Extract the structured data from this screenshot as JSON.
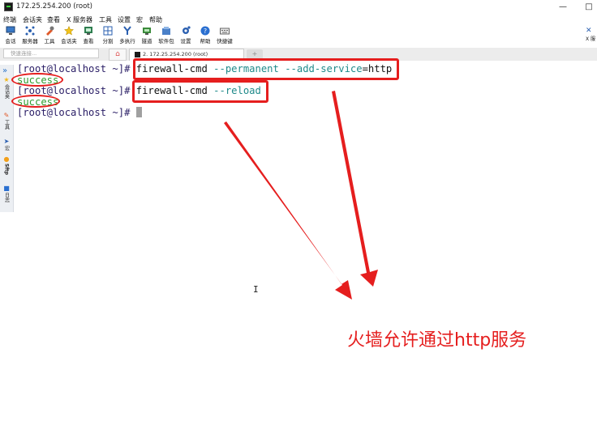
{
  "window": {
    "title": "172.25.254.200 (root)",
    "minimize": "—",
    "maximize": "□"
  },
  "menu": [
    "终端",
    "会话夹",
    "查看",
    "X 服务器",
    "工具",
    "设置",
    "宏",
    "帮助"
  ],
  "toolbar": [
    {
      "label": "会话",
      "icon": "monitor-icon"
    },
    {
      "label": "服务器",
      "icon": "network-icon"
    },
    {
      "label": "工具",
      "icon": "tools-icon"
    },
    {
      "label": "会话夹",
      "icon": "star-icon"
    },
    {
      "label": "查看",
      "icon": "view-icon"
    },
    {
      "label": "分割",
      "icon": "split-icon"
    },
    {
      "label": "多执行",
      "icon": "fork-icon"
    },
    {
      "label": "隧道",
      "icon": "tunnel-icon"
    },
    {
      "label": "软件包",
      "icon": "package-icon"
    },
    {
      "label": "设置",
      "icon": "gear-icon"
    },
    {
      "label": "帮助",
      "icon": "help-icon"
    },
    {
      "label": "快捷键",
      "icon": "keyboard-icon"
    }
  ],
  "toolbar_extra": {
    "label": "X 服"
  },
  "tabs": {
    "quick_connect_placeholder": "快速连接...",
    "active": "2. 172.25.254.200 (root)",
    "home_glyph": "⌂",
    "new_glyph": "+"
  },
  "sidebar": {
    "items": [
      "会话夹",
      "工具",
      "宏",
      "Sftp",
      "日志"
    ]
  },
  "terminal": {
    "prompt": "[root@localhost ~]# ",
    "lines": [
      {
        "cmd": "firewall-cmd ",
        "opt": "--permanent --add-service",
        "rest": "=http"
      },
      {
        "output": "success"
      },
      {
        "cmd": "firewall-cmd ",
        "opt": "--reload",
        "rest": ""
      },
      {
        "output": "success"
      }
    ]
  },
  "annotation": {
    "text": "火墙允许通过http服务",
    "color": "#e51e1e"
  }
}
